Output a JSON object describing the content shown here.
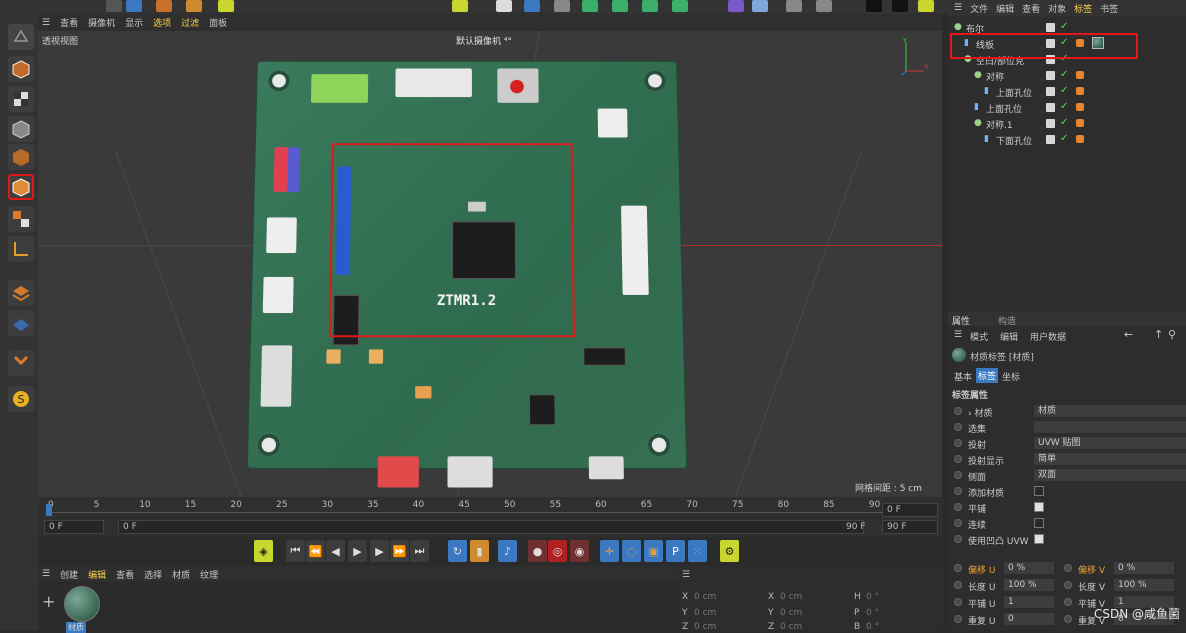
{
  "viewport": {
    "menu": [
      "查看",
      "摄像机",
      "显示",
      "选项",
      "过滤",
      "面板"
    ],
    "active_menu": [
      "选项",
      "过滤"
    ],
    "view_label": "透视视图",
    "camera_label": "默认摄像机 ⁴°",
    "grid_spacing": "网格间距 : 5 cm",
    "pcb_label": "ZTMR1.2"
  },
  "timeline": {
    "ticks": [
      "0",
      "5",
      "10",
      "15",
      "20",
      "25",
      "30",
      "35",
      "40",
      "45",
      "50",
      "55",
      "60",
      "65",
      "70",
      "75",
      "80",
      "85",
      "90"
    ],
    "start_frame": "0 F",
    "current_frame": "0 F",
    "end_frame": "90 F",
    "end_frame2": "90 F",
    "right_frame": "0 F"
  },
  "material_manager": {
    "menu": [
      "创建",
      "编辑",
      "查看",
      "选择",
      "材质",
      "纹理"
    ],
    "active_menu": "编辑",
    "material_name": "材质"
  },
  "coords": {
    "rows": [
      {
        "a": "X",
        "av": "0 cm",
        "b": "X",
        "bv": "0 cm",
        "c": "H",
        "cv": "0 °"
      },
      {
        "a": "Y",
        "av": "0 cm",
        "b": "Y",
        "bv": "0 cm",
        "c": "P",
        "cv": "0 °"
      },
      {
        "a": "Z",
        "av": "0 cm",
        "b": "Z",
        "bv": "0 cm",
        "c": "B",
        "cv": "0 °"
      }
    ]
  },
  "object_manager": {
    "menu": [
      "文件",
      "编辑",
      "查看",
      "对象",
      "标签",
      "书签"
    ],
    "active_menu": "标签",
    "objects": [
      {
        "name": "布尔",
        "indent": 0
      },
      {
        "name": "线板",
        "indent": 1
      },
      {
        "name": "空白/部位克",
        "indent": 1
      },
      {
        "name": "对称",
        "indent": 2
      },
      {
        "name": "上面孔位",
        "indent": 3
      },
      {
        "name": "上面孔位",
        "indent": 2
      },
      {
        "name": "对称.1",
        "indent": 2
      },
      {
        "name": "下面孔位",
        "indent": 3
      }
    ]
  },
  "attributes": {
    "tabs": [
      "属性",
      "构造"
    ],
    "menu": [
      "模式",
      "编辑",
      "用户数据"
    ],
    "title": "材质标签 [材质]",
    "subtabs": [
      "基本",
      "标签",
      "坐标"
    ],
    "active_subtab": "标签",
    "section": "标签属性",
    "rows": [
      {
        "label": "› 材质",
        "type": "field",
        "value": "材质"
      },
      {
        "label": "选集",
        "type": "field",
        "value": ""
      },
      {
        "label": "投射",
        "type": "field",
        "value": "UVW 贴图"
      },
      {
        "label": "投射显示",
        "type": "field",
        "value": "简单"
      },
      {
        "label": "侧面",
        "type": "field",
        "value": "双面"
      },
      {
        "label": "添加材质",
        "type": "check",
        "value": false
      },
      {
        "label": "平铺",
        "type": "check",
        "value": true
      },
      {
        "label": "连续",
        "type": "check",
        "value": false
      },
      {
        "label": "使用凹凸 UVW",
        "type": "check",
        "value": true
      }
    ],
    "uv": [
      {
        "l": "偏移 U",
        "lv": "0 %",
        "r": "偏移 V",
        "rv": "0 %"
      },
      {
        "l": "长度 U",
        "lv": "100 %",
        "r": "长度 V",
        "rv": "100 %"
      },
      {
        "l": "平铺 U",
        "lv": "1",
        "r": "平铺 V",
        "rv": "1"
      },
      {
        "l": "重复 U",
        "lv": "0",
        "r": "重复 V",
        "rv": "0"
      }
    ]
  },
  "watermark": "CSDN @咸鱼菌"
}
